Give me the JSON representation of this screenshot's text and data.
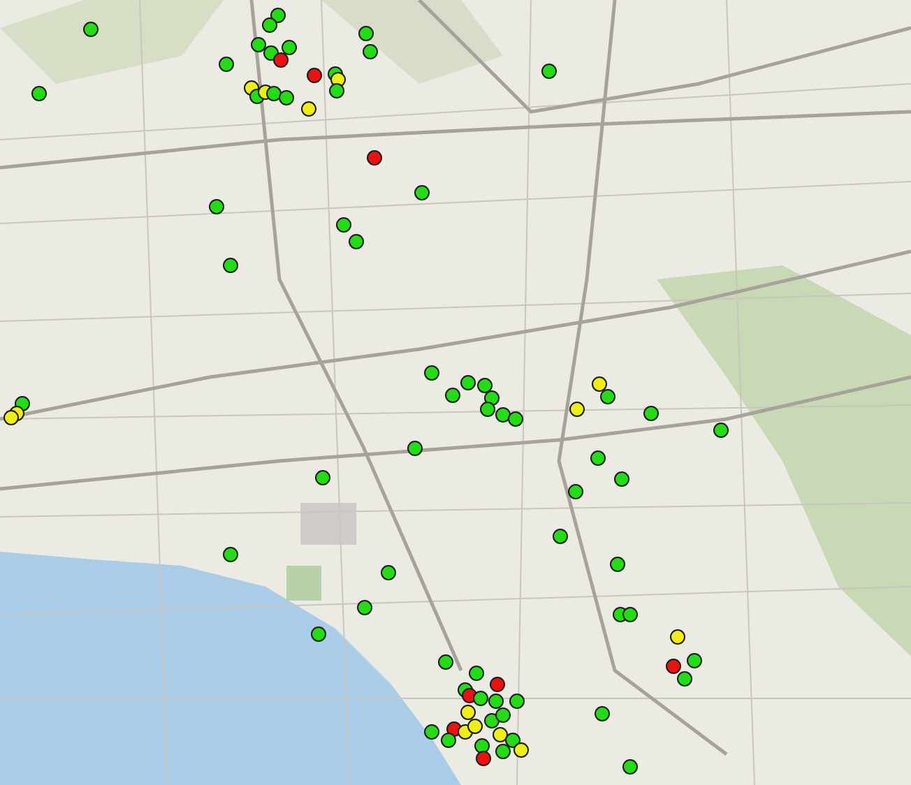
{
  "map": {
    "markers": [
      {
        "color": "#22dd11"
      },
      {
        "color": "#22dd11"
      },
      {
        "color": "#22dd11"
      },
      {
        "color": "#22dd11"
      },
      {
        "color": "#22dd11"
      },
      {
        "color": "#22dd11"
      },
      {
        "color": "#ee1111"
      },
      {
        "color": "#22dd11"
      },
      {
        "color": "#ee1111"
      },
      {
        "color": "#22dd11"
      },
      {
        "color": "#eeee11"
      },
      {
        "color": "#22dd11"
      },
      {
        "color": "#22dd11"
      },
      {
        "color": "#22dd11"
      },
      {
        "color": "#eeee11"
      },
      {
        "color": "#22dd11"
      },
      {
        "color": "#eeee11"
      },
      {
        "color": "#22dd11"
      },
      {
        "color": "#22dd11"
      },
      {
        "color": "#eeee11"
      },
      {
        "color": "#22dd11"
      },
      {
        "color": "#22dd11"
      },
      {
        "color": "#ee1111"
      },
      {
        "color": "#22dd11"
      },
      {
        "color": "#22dd11"
      },
      {
        "color": "#22dd11"
      },
      {
        "color": "#22dd11"
      },
      {
        "color": "#22dd11"
      },
      {
        "color": "#22dd11"
      },
      {
        "color": "#eeee11"
      },
      {
        "color": "#eeee11"
      },
      {
        "color": "#22dd11"
      },
      {
        "color": "#22dd11"
      },
      {
        "color": "#22dd11"
      },
      {
        "color": "#22dd11"
      },
      {
        "color": "#22dd11"
      },
      {
        "color": "#22dd11"
      },
      {
        "color": "#22dd11"
      },
      {
        "color": "#22dd11"
      },
      {
        "color": "#eeee11"
      },
      {
        "color": "#22dd11"
      },
      {
        "color": "#eeee11"
      },
      {
        "color": "#22dd11"
      },
      {
        "color": "#22dd11"
      },
      {
        "color": "#22dd11"
      },
      {
        "color": "#22dd11"
      },
      {
        "color": "#22dd11"
      },
      {
        "color": "#22dd11"
      },
      {
        "color": "#22dd11"
      },
      {
        "color": "#22dd11"
      },
      {
        "color": "#22dd11"
      },
      {
        "color": "#22dd11"
      },
      {
        "color": "#22dd11"
      },
      {
        "color": "#22dd11"
      },
      {
        "color": "#22dd11"
      },
      {
        "color": "#22dd11"
      },
      {
        "color": "#22dd11"
      },
      {
        "color": "#22dd11"
      },
      {
        "color": "#eeee11"
      },
      {
        "color": "#ee1111"
      },
      {
        "color": "#22dd11"
      },
      {
        "color": "#22dd11"
      },
      {
        "color": "#22dd11"
      },
      {
        "color": "#ee1111"
      },
      {
        "color": "#22dd11"
      },
      {
        "color": "#ee1111"
      },
      {
        "color": "#22dd11"
      },
      {
        "color": "#22dd11"
      },
      {
        "color": "#22dd11"
      },
      {
        "color": "#ee1111"
      },
      {
        "color": "#eeee11"
      },
      {
        "color": "#eeee11"
      },
      {
        "color": "#22dd11"
      },
      {
        "color": "#eeee11"
      },
      {
        "color": "#22dd11"
      },
      {
        "color": "#22dd11"
      },
      {
        "color": "#22dd11"
      },
      {
        "color": "#22dd11"
      },
      {
        "color": "#eeee11"
      },
      {
        "color": "#22dd11"
      },
      {
        "color": "#ee1111"
      },
      {
        "color": "#22dd11"
      },
      {
        "color": "#22dd11"
      },
      {
        "color": "#eeee11"
      },
      {
        "color": "#22dd11"
      }
    ]
  }
}
